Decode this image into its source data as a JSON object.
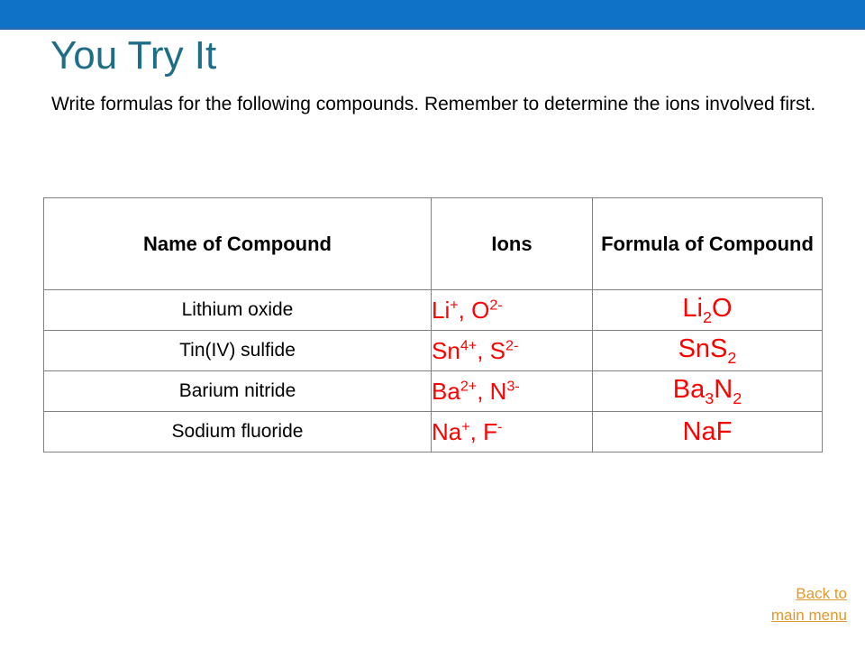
{
  "slide": {
    "title": "You Try It",
    "subtitle": "Write formulas for the following compounds.  Remember to determine the ions involved first.",
    "accent_band_color": "#1072C6",
    "title_color": "#1F6E87",
    "answer_color": "#FF0000",
    "link_color": "#E2982B"
  },
  "table": {
    "headers": {
      "name": "Name of Compound",
      "ions": "Ions",
      "formula": "Formula of Compound"
    },
    "rows": [
      {
        "name": "Lithium oxide",
        "ions_html": "Li<sup>+</sup>, O<sup>2-</sup>",
        "ions_text": "Li+, O2-",
        "formula_html": "Li<sub>2</sub>O",
        "formula_text": "Li2O"
      },
      {
        "name": "Tin(IV) sulfide",
        "ions_html": "Sn<sup>4+</sup>, S<sup>2-</sup>",
        "ions_text": "Sn4+, S2-",
        "formula_html": "SnS<sub>2</sub>",
        "formula_text": "SnS2"
      },
      {
        "name": "Barium nitride",
        "ions_html": "Ba<sup>2+</sup>, N<sup>3-</sup>",
        "ions_text": "Ba2+, N3-",
        "formula_html": "Ba<sub>3</sub>N<sub>2</sub>",
        "formula_text": "Ba3N2"
      },
      {
        "name": "Sodium fluoride",
        "ions_html": "Na<sup>+</sup>, F<sup>-</sup>",
        "ions_text": "Na+, F-",
        "formula_html": "NaF",
        "formula_text": "NaF"
      }
    ]
  },
  "navigation": {
    "back_link_line1": "Back to",
    "back_link_line2": "main menu"
  }
}
